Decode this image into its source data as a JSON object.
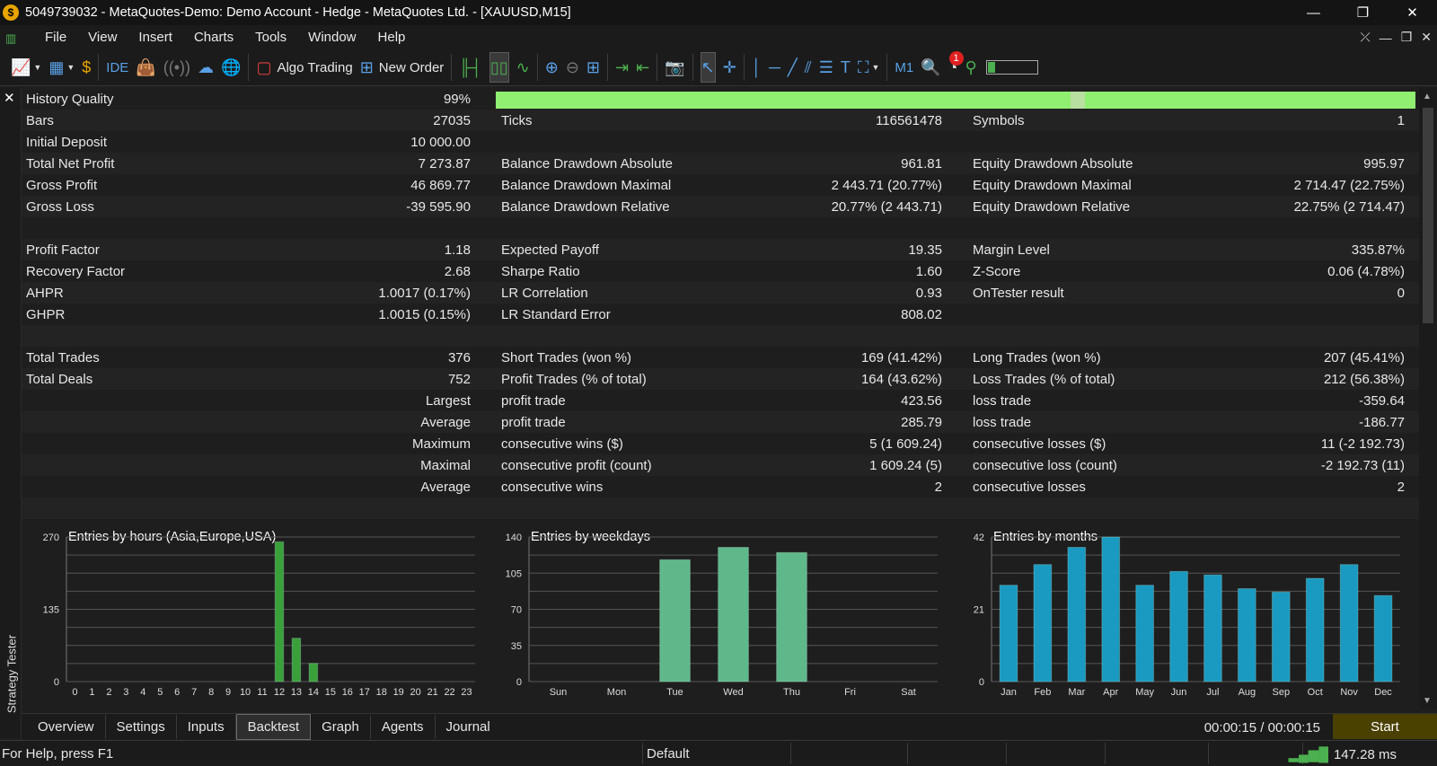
{
  "window": {
    "title": "5049739032 - MetaQuotes-Demo: Demo Account - Hedge - MetaQuotes Ltd. - [XAUUSD,M15]"
  },
  "menu": [
    "File",
    "View",
    "Insert",
    "Charts",
    "Tools",
    "Window",
    "Help"
  ],
  "toolbar": {
    "algo_trading": "Algo Trading",
    "new_order": "New Order",
    "ide": "IDE",
    "timeframe": "M1",
    "notif_count": "1"
  },
  "report": {
    "history_quality_label": "History Quality",
    "history_quality_value": "99%",
    "history_quality_fraction": 0.99,
    "rows": [
      {
        "c1": "Bars",
        "c2": "27035",
        "c3": "Ticks",
        "c4": "116561478",
        "c5": "Symbols",
        "c6": "1"
      },
      {
        "c1": "Initial Deposit",
        "c2": "10 000.00",
        "c3": "",
        "c4": "",
        "c5": "",
        "c6": ""
      },
      {
        "c1": "Total Net Profit",
        "c2": "7 273.87",
        "c3": "Balance Drawdown Absolute",
        "c4": "961.81",
        "c5": "Equity Drawdown Absolute",
        "c6": "995.97"
      },
      {
        "c1": "Gross Profit",
        "c2": "46 869.77",
        "c3": "Balance Drawdown Maximal",
        "c4": "2 443.71 (20.77%)",
        "c5": "Equity Drawdown Maximal",
        "c6": "2 714.47 (22.75%)"
      },
      {
        "c1": "Gross Loss",
        "c2": "-39 595.90",
        "c3": "Balance Drawdown Relative",
        "c4": "20.77% (2 443.71)",
        "c5": "Equity Drawdown Relative",
        "c6": "22.75% (2 714.47)"
      },
      {
        "c1": "",
        "c2": "",
        "c3": "",
        "c4": "",
        "c5": "",
        "c6": ""
      },
      {
        "c1": "Profit Factor",
        "c2": "1.18",
        "c3": "Expected Payoff",
        "c4": "19.35",
        "c5": "Margin Level",
        "c6": "335.87%"
      },
      {
        "c1": "Recovery Factor",
        "c2": "2.68",
        "c3": "Sharpe Ratio",
        "c4": "1.60",
        "c5": "Z-Score",
        "c6": "0.06 (4.78%)"
      },
      {
        "c1": "AHPR",
        "c2": "1.0017 (0.17%)",
        "c3": "LR Correlation",
        "c4": "0.93",
        "c5": "OnTester result",
        "c6": "0"
      },
      {
        "c1": "GHPR",
        "c2": "1.0015 (0.15%)",
        "c3": "LR Standard Error",
        "c4": "808.02",
        "c5": "",
        "c6": ""
      },
      {
        "c1": "",
        "c2": "",
        "c3": "",
        "c4": "",
        "c5": "",
        "c6": ""
      },
      {
        "c1": "Total Trades",
        "c2": "376",
        "c3": "Short Trades (won %)",
        "c4": "169 (41.42%)",
        "c5": "Long Trades (won %)",
        "c6": "207 (45.41%)"
      },
      {
        "c1": "Total Deals",
        "c2": "752",
        "c3": "Profit Trades (% of total)",
        "c4": "164 (43.62%)",
        "c5": "Loss Trades (% of total)",
        "c6": "212 (56.38%)"
      },
      {
        "c1": "",
        "c2": "Largest",
        "c3": "profit trade",
        "c4": "423.56",
        "c5": "loss trade",
        "c6": "-359.64"
      },
      {
        "c1": "",
        "c2": "Average",
        "c3": "profit trade",
        "c4": "285.79",
        "c5": "loss trade",
        "c6": "-186.77"
      },
      {
        "c1": "",
        "c2": "Maximum",
        "c3": "consecutive wins ($)",
        "c4": "5 (1 609.24)",
        "c5": "consecutive losses ($)",
        "c6": "11 (-2 192.73)"
      },
      {
        "c1": "",
        "c2": "Maximal",
        "c3": "consecutive profit (count)",
        "c4": "1 609.24 (5)",
        "c5": "consecutive loss (count)",
        "c6": "-2 192.73 (11)"
      },
      {
        "c1": "",
        "c2": "Average",
        "c3": "consecutive wins",
        "c4": "2",
        "c5": "consecutive losses",
        "c6": "2"
      },
      {
        "c1": "",
        "c2": "",
        "c3": "",
        "c4": "",
        "c5": "",
        "c6": ""
      }
    ]
  },
  "chart_data": [
    {
      "type": "bar",
      "title": "Entries by hours (Asia,Europe,USA)",
      "categories": [
        "0",
        "1",
        "2",
        "3",
        "4",
        "5",
        "6",
        "7",
        "8",
        "9",
        "10",
        "11",
        "12",
        "13",
        "14",
        "15",
        "16",
        "17",
        "18",
        "19",
        "20",
        "21",
        "22",
        "23"
      ],
      "values": [
        0,
        0,
        0,
        0,
        0,
        0,
        0,
        0,
        0,
        0,
        0,
        0,
        261,
        81,
        34,
        0,
        0,
        0,
        0,
        0,
        0,
        0,
        0,
        0
      ],
      "yticks": [
        "270",
        "135",
        "0"
      ],
      "ylim": [
        0,
        270
      ],
      "color": "#3aa03a",
      "grid": true
    },
    {
      "type": "bar",
      "title": "Entries by weekdays",
      "categories": [
        "Sun",
        "Mon",
        "Tue",
        "Wed",
        "Thu",
        "Fri",
        "Sat"
      ],
      "values": [
        0,
        0,
        118,
        130,
        125,
        0,
        0
      ],
      "yticks": [
        "140",
        "105",
        "70",
        "35",
        "0"
      ],
      "ylim": [
        0,
        140
      ],
      "color": "#5fb88a",
      "grid": true
    },
    {
      "type": "bar",
      "title": "Entries by months",
      "categories": [
        "Jan",
        "Feb",
        "Mar",
        "Apr",
        "May",
        "Jun",
        "Jul",
        "Aug",
        "Sep",
        "Oct",
        "Nov",
        "Dec"
      ],
      "values": [
        28,
        34,
        39,
        42,
        28,
        32,
        31,
        27,
        26,
        30,
        34,
        25
      ],
      "yticks": [
        "42",
        "21",
        "0"
      ],
      "ylim": [
        0,
        42
      ],
      "color": "#1a9ac0",
      "grid": true
    }
  ],
  "sidebar": {
    "title": "Strategy Tester"
  },
  "tabs": [
    "Overview",
    "Settings",
    "Inputs",
    "Backtest",
    "Graph",
    "Agents",
    "Journal"
  ],
  "active_tab": "Backtest",
  "timer": "00:00:15 / 00:00:15",
  "start_button": "Start",
  "status": {
    "help": "For Help, press F1",
    "profile": "Default",
    "ping": "147.28 ms"
  },
  "colors": {
    "quality_bar": "#90ee70",
    "start_button": "#4a4000"
  }
}
